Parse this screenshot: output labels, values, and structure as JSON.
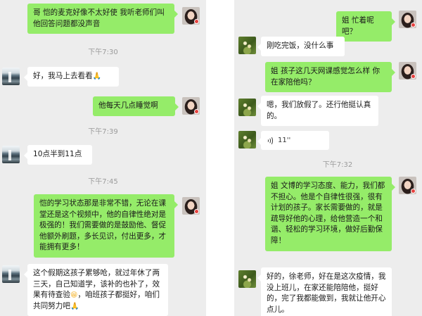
{
  "left": {
    "messages": [
      {
        "text": "哥 恺的麦克好像不太好使 我听老师们叫他回答问题都没声音"
      },
      {
        "time": "下午7:30"
      },
      {
        "text": "好，我马上去看看",
        "emoji": "🙏"
      },
      {
        "text": "他每天几点睡觉啊"
      },
      {
        "time": "下午7:39"
      },
      {
        "text": "10点半到11点"
      },
      {
        "time": "下午7:45"
      },
      {
        "text": "恺的学习状态那是非常不错，无论在课堂还是这个视频中，他的自律性绝对是极强的！我们需要做的是鼓励他、督促他额外刷题，多长见识，付出更多，才能拥有更多！"
      },
      {
        "text_a": "这个假期这孩子累够呛，就过年休了两三天，自己知道学，该补的也补了，效果有待查验",
        "emoji_a": "😁",
        "text_b": "，咱班孩子都挺好，咱们共同努力吧",
        "emoji_b": "🙏"
      }
    ]
  },
  "right": {
    "messages": [
      {
        "text": "姐 忙着呢吧？"
      },
      {
        "text": "刚吃完饭，没什么事"
      },
      {
        "text": "姐 孩子这几天网课感觉怎么样 你在家陪他吗？"
      },
      {
        "text": "嗯，我们放假了。还行他挺认真的。"
      },
      {
        "voice_length": "11''"
      },
      {
        "time": "下午7:32"
      },
      {
        "text": "姐 文博的学习态度、能力，我们都不担心。他是个自律性很强，很有计划的孩子。家长需要做的，就是疏导好他的心理，给他营造一个和谐、轻松的学习环境，做好后勤保障！"
      },
      {
        "text": "好的，徐老师，好在是这次疫情，我没上班儿，在家还能陪陪他，挺好的，完了我都能做到，我就让他开心点儿。"
      }
    ]
  },
  "colors": {
    "sent_bubble": "#95ec69",
    "received_bubble": "#ffffff",
    "background": "#ededed"
  },
  "icons": {
    "voice": "voice-wave-icon",
    "unread_badge": "red-dot-badge"
  }
}
